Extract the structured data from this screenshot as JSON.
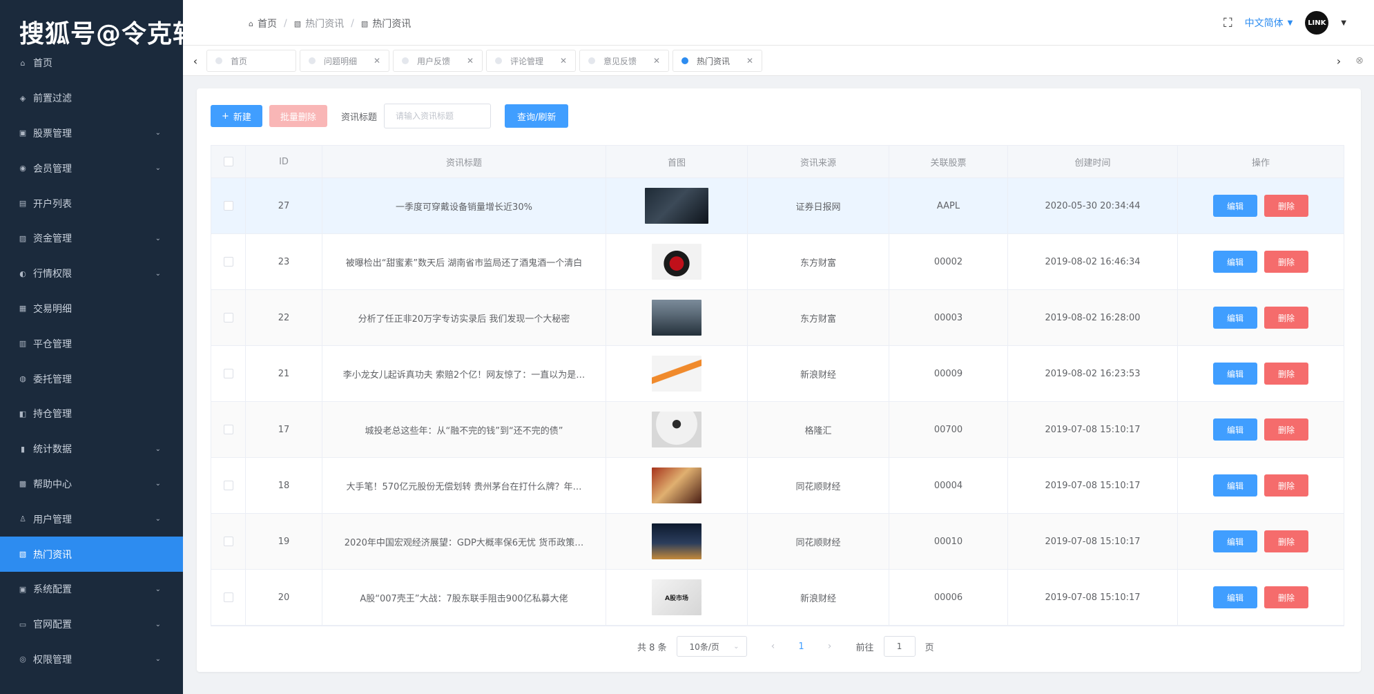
{
  "watermark": "搜狐号@令克软件",
  "sidebar": {
    "items": [
      {
        "label": "首页",
        "icon": "home-icon",
        "glyph": "⌂",
        "arrow": ""
      },
      {
        "label": "前置过滤",
        "icon": "filter-icon",
        "glyph": "◈",
        "arrow": ""
      },
      {
        "label": "股票管理",
        "icon": "stock-icon",
        "glyph": "▣",
        "arrow": "⌄"
      },
      {
        "label": "会员管理",
        "icon": "member-icon",
        "glyph": "◉",
        "arrow": "⌄"
      },
      {
        "label": "开户列表",
        "icon": "list-icon",
        "glyph": "▤",
        "arrow": ""
      },
      {
        "label": "资金管理",
        "icon": "fund-icon",
        "glyph": "▨",
        "arrow": "⌄"
      },
      {
        "label": "行情权限",
        "icon": "market-icon",
        "glyph": "◐",
        "arrow": "⌄"
      },
      {
        "label": "交易明细",
        "icon": "trade-icon",
        "glyph": "▦",
        "arrow": ""
      },
      {
        "label": "平仓管理",
        "icon": "close-position-icon",
        "glyph": "▥",
        "arrow": ""
      },
      {
        "label": "委托管理",
        "icon": "entrust-icon",
        "glyph": "◍",
        "arrow": ""
      },
      {
        "label": "持仓管理",
        "icon": "position-icon",
        "glyph": "◧",
        "arrow": ""
      },
      {
        "label": "统计数据",
        "icon": "stats-icon",
        "glyph": "▮",
        "arrow": "⌄"
      },
      {
        "label": "帮助中心",
        "icon": "help-icon",
        "glyph": "▩",
        "arrow": "⌄"
      },
      {
        "label": "用户管理",
        "icon": "user-icon",
        "glyph": "♙",
        "arrow": "⌄"
      },
      {
        "label": "热门资讯",
        "icon": "news-icon",
        "glyph": "▧",
        "arrow": ""
      },
      {
        "label": "系统配置",
        "icon": "system-icon",
        "glyph": "▣",
        "arrow": "⌄"
      },
      {
        "label": "官网配置",
        "icon": "website-icon",
        "glyph": "▭",
        "arrow": "⌄"
      },
      {
        "label": "权限管理",
        "icon": "permission-icon",
        "glyph": "◎",
        "arrow": "⌄"
      }
    ],
    "active_index": 14
  },
  "header": {
    "breadcrumb": [
      "首页",
      "热门资讯",
      "热门资讯"
    ],
    "language": "中文简体",
    "avatar_text": "LINK"
  },
  "tabs": [
    {
      "label": "首页",
      "closable": false,
      "active": false
    },
    {
      "label": "问题明细",
      "closable": true,
      "active": false
    },
    {
      "label": "用户反馈",
      "closable": true,
      "active": false
    },
    {
      "label": "评论管理",
      "closable": true,
      "active": false
    },
    {
      "label": "意见反馈",
      "closable": true,
      "active": false
    },
    {
      "label": "热门资讯",
      "closable": true,
      "active": true
    }
  ],
  "toolbar": {
    "new_label": "新建",
    "batch_delete_label": "批量删除",
    "search_label": "资讯标题",
    "search_placeholder": "请输入资讯标题",
    "query_label": "查询/刷新"
  },
  "table": {
    "columns": [
      "ID",
      "资讯标题",
      "首图",
      "资讯来源",
      "关联股票",
      "创建时间",
      "操作"
    ],
    "edit_label": "编辑",
    "delete_label": "删除",
    "rows": [
      {
        "id": "27",
        "title": "一季度可穿戴设备销量增长近30%",
        "source": "证券日报网",
        "stock": "AAPL",
        "time": "2020-05-30 20:34:44",
        "thumb": "thumb-dark"
      },
      {
        "id": "23",
        "title": "被曝检出“甜蜜素”数天后 湖南省市监局还了酒鬼酒一个清白",
        "source": "东方财富",
        "stock": "00002",
        "time": "2019-08-02 16:46:34",
        "thumb": "thumb-bottle"
      },
      {
        "id": "22",
        "title": "分析了任正非20万字专访实录后 我们发现一个大秘密",
        "source": "东方财富",
        "stock": "00003",
        "time": "2019-08-02 16:28:00",
        "thumb": "thumb-person"
      },
      {
        "id": "21",
        "title": "李小龙女儿起诉真功夫 索赔2个亿！网友惊了：一直以为是…",
        "source": "新浪财经",
        "stock": "00009",
        "time": "2019-08-02 16:23:53",
        "thumb": "thumb-scissors"
      },
      {
        "id": "17",
        "title": "城投老总这些年：从“融不完的钱”到“还不完的债”",
        "source": "格隆汇",
        "stock": "00700",
        "time": "2019-07-08 15:10:17",
        "thumb": "thumb-clock"
      },
      {
        "id": "18",
        "title": "大手笔！570亿元股份无偿划转 贵州茅台在打什么牌？年…",
        "source": "同花顺财经",
        "stock": "00004",
        "time": "2019-07-08 15:10:17",
        "thumb": "thumb-store"
      },
      {
        "id": "19",
        "title": "2020年中国宏观经济展望：GDP大概率保6无忧 货币政策…",
        "source": "同花顺财经",
        "stock": "00010",
        "time": "2019-07-08 15:10:17",
        "thumb": "thumb-city"
      },
      {
        "id": "20",
        "title": "A股“007壳王”大战：7股东联手阻击900亿私募大佬",
        "source": "新浪财经",
        "stock": "00006",
        "time": "2019-07-08 15:10:17",
        "thumb": "thumb-market"
      }
    ]
  },
  "pagination": {
    "total_text": "共 8 条",
    "page_size": "10条/页",
    "current_page": "1",
    "goto_prefix": "前往",
    "goto_value": "1",
    "goto_suffix": "页"
  },
  "thumb_text": {
    "market": "A股市场"
  },
  "colors": {
    "sidebar_bg": "#1b2a3c",
    "active_menu": "#2d8cf0",
    "primary": "#409eff",
    "danger": "#f56c6c"
  }
}
